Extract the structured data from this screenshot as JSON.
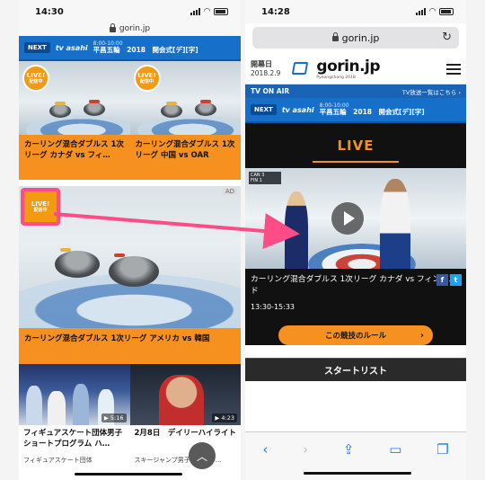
{
  "left": {
    "time": "14:30",
    "url": "gorin.jp",
    "nextbar": {
      "badge": "NEXT",
      "channel": "tv asahi",
      "time": "8:00-10:00",
      "title": "平昌五輪　2018　開会式[デ][字]"
    },
    "cards": [
      {
        "live": "LIVE!",
        "live_sub": "配信中",
        "title": "カーリング混合ダブルス 1次リーグ カナダ vs フィ…"
      },
      {
        "live": "LIVE!",
        "live_sub": "配信中",
        "title": "カーリング混合ダブルス 1次リーグ 中国 vs OAR"
      }
    ],
    "big_card": {
      "live": "LIVE!",
      "live_sub": "配信中",
      "ad": "AD",
      "title": "カーリング混合ダブルス 1次リーグ アメリカ vs 韓国"
    },
    "bottom_cards": [
      {
        "duration": "▶ 5:16",
        "title": "フィギュアスケート団体男子ショートプログラム ハ…",
        "sub": "フィギュアスケート団体"
      },
      {
        "duration": "▶ 4:23",
        "title": "2月8日　デイリーハイライト",
        "sub": "スキージャンプ男子ノーマル…"
      }
    ],
    "scroll_up_icon": "chevron-up-icon"
  },
  "right": {
    "time": "14:28",
    "url": "gorin.jp",
    "open_date_label": "開幕日",
    "open_date": "2018.2.9",
    "brand": "gorin.jp",
    "brand_sub": "Pyeongchang 2018",
    "onair": {
      "label": "TV ON AIR",
      "link": "TV放送一覧はこちら ›"
    },
    "nextbar": {
      "badge": "NEXT",
      "channel": "tv asahi",
      "time": "8:00-10:00",
      "title": "平昌五輪　2018　開会式[デ][字]"
    },
    "live_title": "LIVE",
    "video": {
      "title": "カーリング混合ダブルス 1次リーグ カナダ vs フィンランド",
      "time": "13:30-15:33",
      "fb": "f",
      "tw": "t"
    },
    "rule_button": "この競技のルール",
    "start_list": "スタートリスト"
  },
  "colors": {
    "orange": "#f6901e",
    "blue": "#1670c9",
    "highlight": "#ff4b86"
  }
}
